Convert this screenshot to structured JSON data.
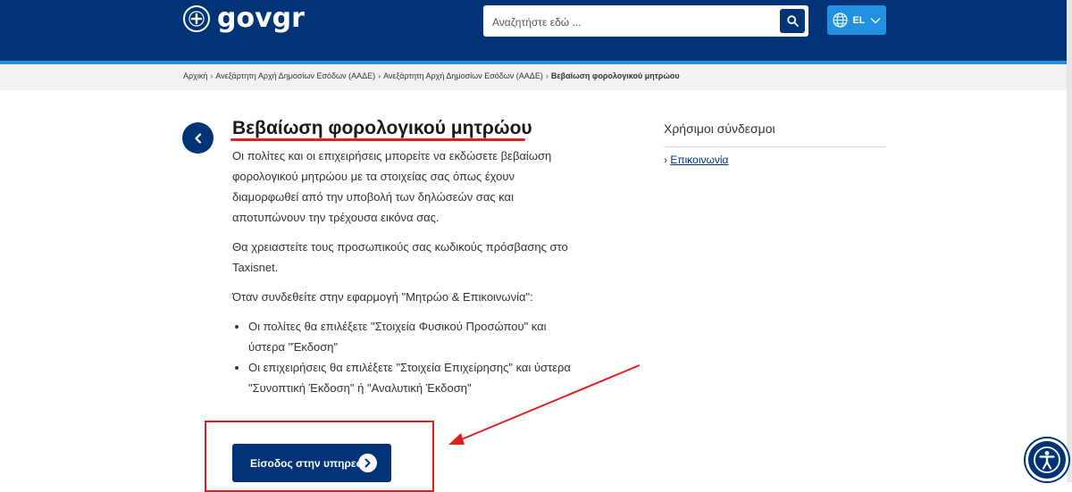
{
  "header": {
    "logo_text": "govgr",
    "search_placeholder": "Αναζητήστε εδώ ...",
    "language": "EL",
    "colors": {
      "primary": "#003476",
      "accent": "#2190e0"
    }
  },
  "breadcrumb": {
    "items": [
      "Αρχική",
      "Ανεξάρτητη Αρχή Δημοσίων Εσόδων (ΑΑΔΕ)",
      "Ανεξάρτητη Αρχή Δημοσίων Εσόδων (ΑΑΔΕ)"
    ],
    "current": "Βεβαίωση φορολογικού μητρώου"
  },
  "main": {
    "title": "Βεβαίωση φορολογικού μητρώου",
    "paragraphs": [
      "Οι πολίτες και οι επιχειρήσεις μπορείτε να εκδώσετε βεβαίωση φορολογικού μητρώου με τα στοιχείας σας όπως έχουν διαμορφωθεί από την υποβολή των δηλώσεών σας και αποτυπώνουν την τρέχουσα εικόνα σας.",
      "Θα χρειαστείτε τους προσωπικούς σας κωδικούς πρόσβασης στο Taxisnet.",
      "Όταν συνδεθείτε στην εφαρμογή \"Μητρώο & Επικοινωνία\":"
    ],
    "bullets": [
      "Οι πολίτες θα επιλέξετε \"Στοιχεία Φυσικού Προσώπου\" και ύστερα \"Έκδοση\"",
      "Οι επιχειρήσεις θα επιλέξετε \"Στοιχεία Επιχείρησης\" και ύστερα \"Συνοπτική Έκδοση\" ή \"Αναλυτική Έκδοση\""
    ],
    "cta_label": "Είσοδος στην υπηρεσία"
  },
  "sidebar": {
    "title": "Χρήσιμοι σύνδεσμοι",
    "links": [
      "Επικοινωνία"
    ]
  },
  "annotations": {
    "highlight_color": "#e02020"
  },
  "icons": [
    "emblem-icon",
    "search-icon",
    "globe-icon",
    "chevron-down-icon",
    "back-arrow-icon",
    "chevron-right-icon",
    "accessibility-icon"
  ]
}
